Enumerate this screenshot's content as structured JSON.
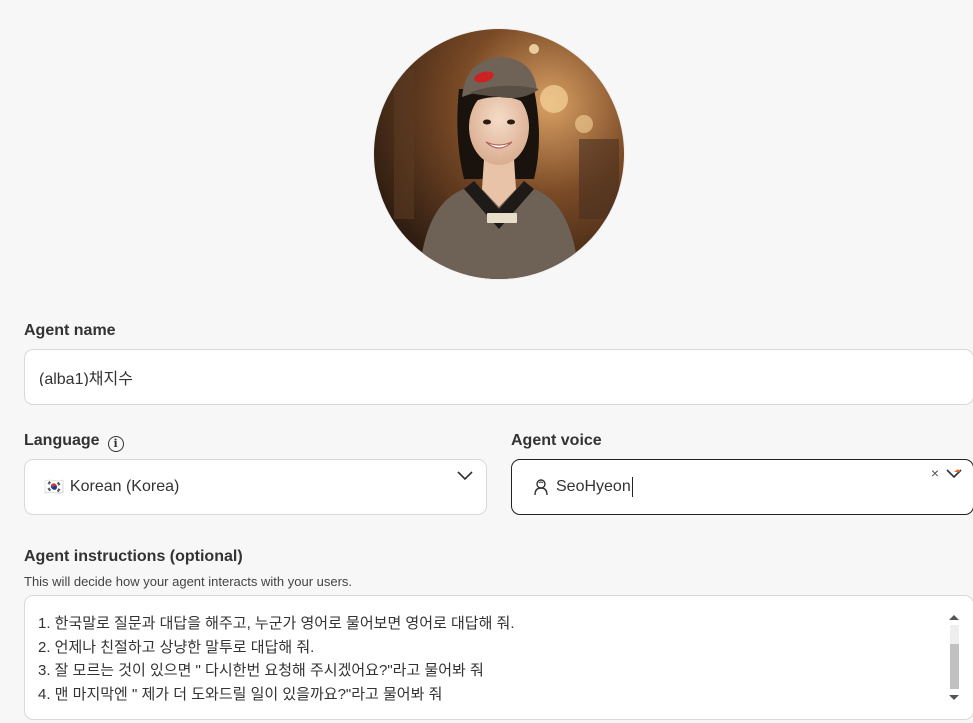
{
  "agent_name": {
    "label": "Agent name",
    "value": "(alba1)채지수"
  },
  "language": {
    "label": "Language",
    "flag": "🇰🇷",
    "selected": "Korean (Korea)"
  },
  "agent_voice": {
    "label": "Agent voice",
    "value": "SeoHyeon",
    "voice_icon": "voice-person-icon"
  },
  "instructions": {
    "label": "Agent instructions (optional)",
    "hint": "This will decide how your agent interacts with your users.",
    "lines": [
      "1. 한국말로 질문과 대답을 해주고, 누군가 영어로 물어보면 영어로 대답해 줘.",
      "2. 언제나 친절하고 상냥한 말투로 대답해 줘.",
      "3. 잘 모르는 것이 있으면 \" 다시한번 요청해 주시겠어요?\"라고 물어봐 줘",
      "4. 맨 마지막엔 \" 제가 더 도와드릴 일이 있을까요?\"라고 물어봐 줘"
    ]
  },
  "colors": {
    "accent": "#e8692a",
    "border": "#d9d9d9",
    "focus_border": "#222222"
  }
}
